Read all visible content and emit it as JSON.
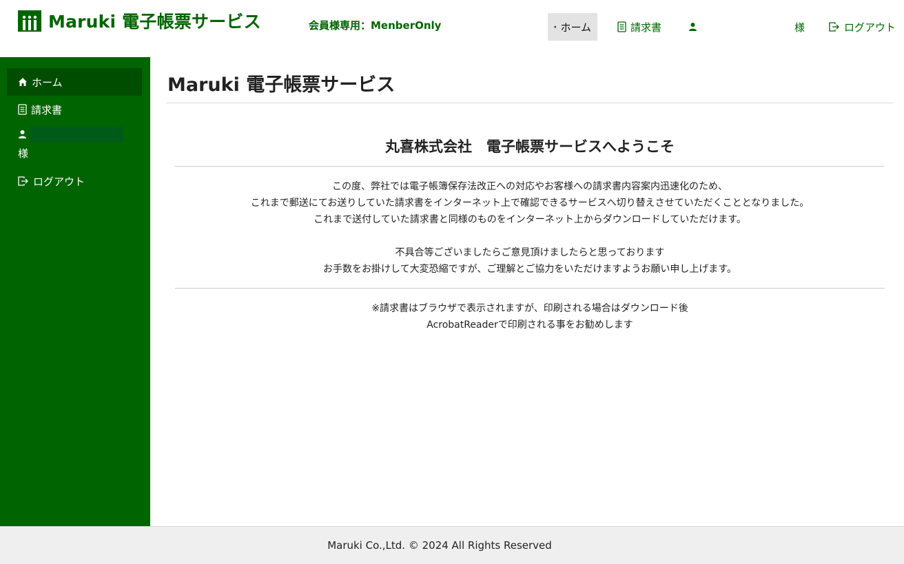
{
  "brand": {
    "title": "Maruki 電子帳票サービス",
    "color": "#006400"
  },
  "header": {
    "member_label": "会員様専用：MenberOnly",
    "nav": {
      "home": {
        "label": "ホーム",
        "icon": "home-icon"
      },
      "invoice": {
        "label": "請求書",
        "icon": "document-icon"
      },
      "user": {
        "icon": "user-icon"
      },
      "sama": "様",
      "logout": {
        "label": "ログアウト",
        "icon": "logout-icon"
      }
    }
  },
  "sidebar": {
    "items": [
      {
        "label": "ホーム",
        "icon": "home-icon"
      },
      {
        "label": "請求書",
        "icon": "document-icon"
      },
      {
        "label": "様",
        "icon": "user-icon"
      },
      {
        "label": "ログアウト",
        "icon": "logout-icon"
      }
    ]
  },
  "main": {
    "page_title": "Maruki 電子帳票サービス",
    "welcome": "丸喜株式会社　電子帳票サービスへようこそ",
    "para1": [
      "この度、弊社では電子帳簿保存法改正への対応やお客様への請求書内容案内迅速化のため、",
      "これまで郵送にてお送りしていた請求書をインターネット上で確認できるサービスへ切り替えさせていただくこととなりました。",
      "これまで送付していた請求書と同様のものをインターネット上からダウンロードしていただけます。"
    ],
    "para2": [
      "不具合等ございましたらご意見頂けましたらと思っております",
      "お手数をお掛けして大変恐縮ですが、ご理解とご協力をいただけますようお願い申し上げます。"
    ],
    "note": [
      "※請求書はブラウザで表示されますが、印刷される場合はダウンロード後",
      "AcrobatReaderで印刷される事をお勧めします"
    ]
  },
  "footer": {
    "copyright": "Maruki Co.,Ltd. © 2024 All Rights Reserved"
  }
}
